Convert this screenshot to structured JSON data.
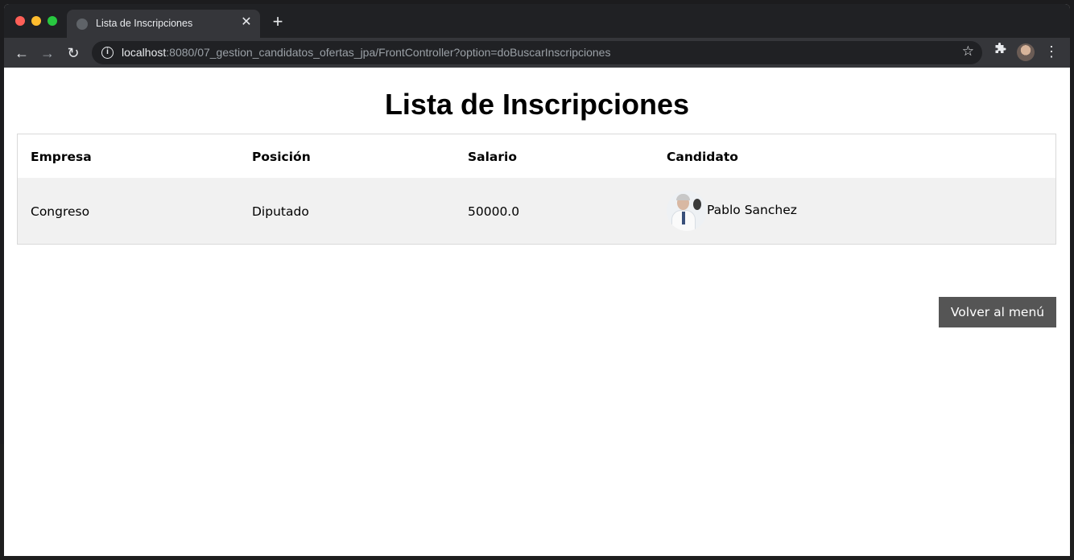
{
  "browser": {
    "tab_title": "Lista de Inscripciones",
    "tab_close": "✕",
    "new_tab": "+",
    "url_host": "localhost",
    "url_rest": ":8080/07_gestion_candidatos_ofertas_jpa/FrontController?option=doBuscarInscripciones",
    "info_icon": "i",
    "star_icon": "☆",
    "extensions_icon": "puzzle-icon",
    "menu_icon": "⋮",
    "back_icon": "←",
    "forward_icon": "→",
    "reload_icon": "↻"
  },
  "page": {
    "title": "Lista de Inscripciones",
    "table": {
      "headers": [
        "Empresa",
        "Posición",
        "Salario",
        "Candidato"
      ],
      "rows": [
        {
          "empresa": "Congreso",
          "posicion": "Diputado",
          "salario": "50000.0",
          "candidato": "Pablo Sanchez"
        }
      ]
    },
    "back_button": "Volver al menú"
  }
}
